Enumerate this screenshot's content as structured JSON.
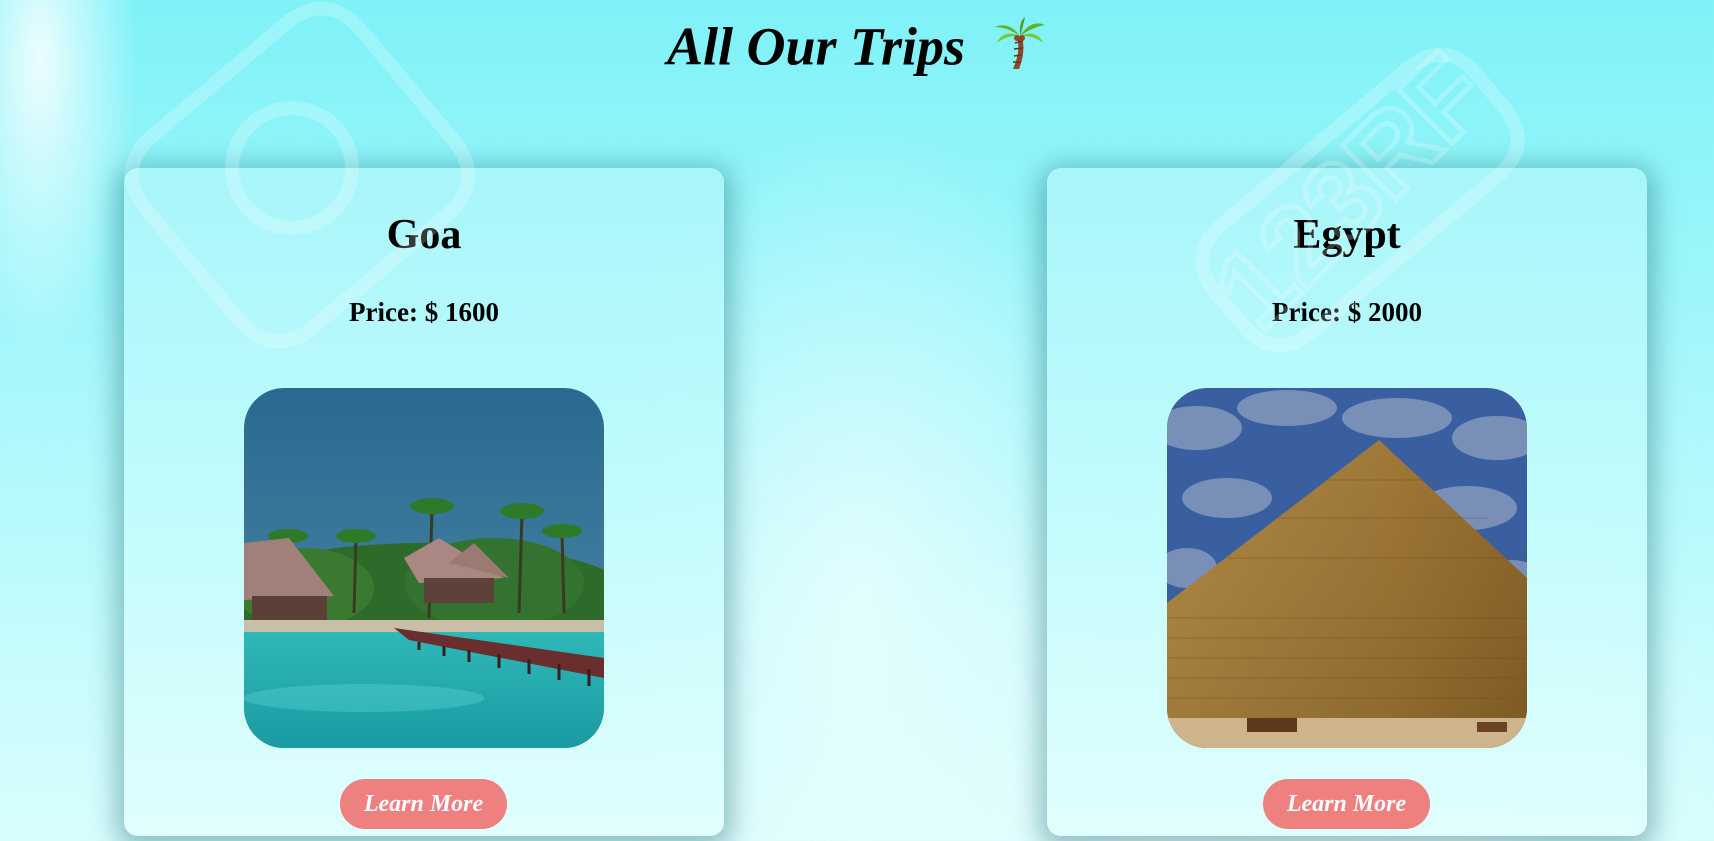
{
  "page": {
    "title": "All Our Trips",
    "title_icon": "palm-tree-icon"
  },
  "trips": [
    {
      "name": "Goa",
      "price": "Price: $ 1600",
      "image": "goa-beach-resort-image",
      "button_label": "Learn More"
    },
    {
      "name": "Egypt",
      "price": "Price: $ 2000",
      "image": "egypt-pyramid-image",
      "button_label": "Learn More"
    }
  ],
  "watermark": {
    "brand": "123RF"
  },
  "colors": {
    "background": "#9ef6fa",
    "card": "#c8fcfc",
    "button": "#ef8080",
    "button_text": "#ffffff",
    "text": "#000000"
  }
}
